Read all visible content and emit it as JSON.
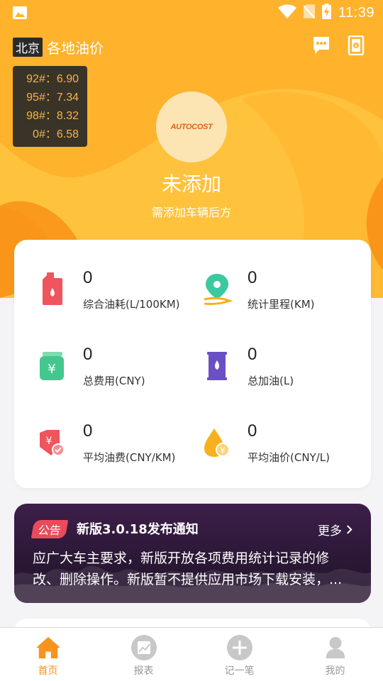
{
  "status_bar": {
    "time": "11:39"
  },
  "header": {
    "city": "北京",
    "title": "各地油价"
  },
  "fuel_prices": [
    {
      "label": "92#：6.90"
    },
    {
      "label": "95#：7.34"
    },
    {
      "label": "98#：8.32"
    },
    {
      "label": "0#：6.58"
    }
  ],
  "car": {
    "logo_text": "AUTOCOST",
    "name": "未添加",
    "hint": "需添加车辆后方"
  },
  "stats": [
    {
      "value": "0",
      "label": "综合油耗(L/100KM)",
      "icon": "fuel-can-icon",
      "color": "#f0545d"
    },
    {
      "value": "0",
      "label": "统计里程(KM)",
      "icon": "location-pin-icon",
      "color": "#3cc8a0"
    },
    {
      "value": "0",
      "label": "总费用(CNY)",
      "icon": "money-jar-icon",
      "color": "#44c78f"
    },
    {
      "value": "0",
      "label": "总加油(L)",
      "icon": "oil-barrel-icon",
      "color": "#6b4fc6"
    },
    {
      "value": "0",
      "label": "平均油费(CNY/KM)",
      "icon": "money-tag-icon",
      "color": "#f0545d"
    },
    {
      "value": "0",
      "label": "平均油价(CNY/L)",
      "icon": "fuel-drop-icon",
      "color": "#f7b11e"
    }
  ],
  "notice": {
    "tag": "公告",
    "title": "新版3.0.18发布通知",
    "more": "更多",
    "body": "应广大车主要求，新版开放各项费用统计记录的修改、删除操作。新版暂不提供应用市场下载安装，..."
  },
  "tabs": [
    {
      "label": "首页",
      "icon": "home-icon",
      "active": true
    },
    {
      "label": "报表",
      "icon": "chart-icon",
      "active": false
    },
    {
      "label": "记一笔",
      "icon": "plus-icon",
      "active": false
    },
    {
      "label": "我的",
      "icon": "user-icon",
      "active": false
    }
  ],
  "colors": {
    "brand": "#f7931e",
    "hero_light": "#ffc23d",
    "hero_dark": "#f99a1c"
  }
}
